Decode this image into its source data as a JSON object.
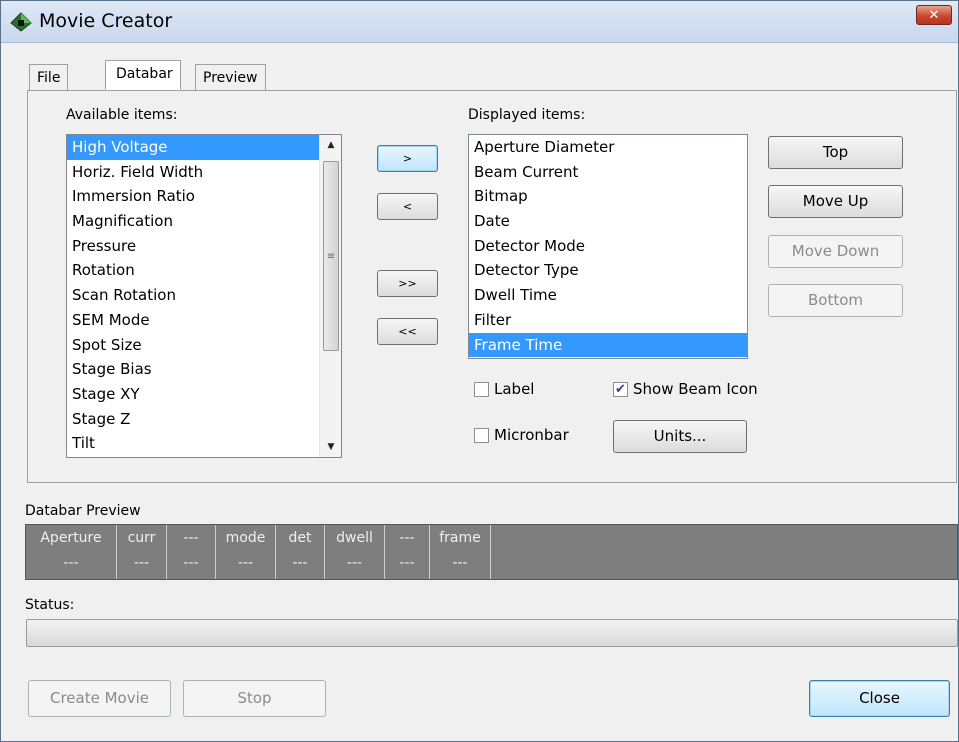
{
  "window": {
    "title": "Movie Creator",
    "close_glyph": "✕"
  },
  "tabs": [
    {
      "label": "File"
    },
    {
      "label": "Databar"
    },
    {
      "label": "Preview"
    }
  ],
  "available": {
    "label": "Available items:",
    "items": [
      "High Voltage",
      "Horiz. Field Width",
      "Immersion Ratio",
      "Magnification",
      "Pressure",
      "Rotation",
      "Scan Rotation",
      "SEM Mode",
      "Spot Size",
      "Stage Bias",
      "Stage XY",
      "Stage Z",
      "Tilt"
    ],
    "selected": "High Voltage"
  },
  "transfer_buttons": {
    "add": ">",
    "remove": "<",
    "add_all": ">>",
    "remove_all": "<<"
  },
  "displayed": {
    "label": "Displayed items:",
    "items": [
      "Aperture Diameter",
      "Beam Current",
      "Bitmap",
      "Date",
      "Detector Mode",
      "Detector Type",
      "Dwell Time",
      "Filter",
      "Frame Time"
    ],
    "selected": "Frame Time"
  },
  "order_buttons": {
    "top": "Top",
    "move_up": "Move Up",
    "move_down": "Move Down",
    "bottom": "Bottom"
  },
  "options": {
    "label": {
      "text": "Label",
      "checked": false
    },
    "show_beam_icon": {
      "text": "Show Beam Icon",
      "checked": true
    },
    "micronbar": {
      "text": "Micronbar",
      "checked": false
    },
    "units_button": "Units..."
  },
  "databar_preview": {
    "label": "Databar Preview",
    "cells": [
      {
        "header": "Aperture",
        "value": "---"
      },
      {
        "header": "curr",
        "value": "---"
      },
      {
        "header": "---",
        "value": "---"
      },
      {
        "header": "mode",
        "value": "---"
      },
      {
        "header": "det",
        "value": "---"
      },
      {
        "header": "dwell",
        "value": "---"
      },
      {
        "header": "---",
        "value": "---"
      },
      {
        "header": "frame",
        "value": "---"
      }
    ]
  },
  "status": {
    "label": "Status:",
    "progress": 0
  },
  "footer": {
    "create_movie": "Create Movie",
    "stop": "Stop",
    "close": "Close"
  },
  "colors": {
    "selection": "#3399ff",
    "preview_bg": "#7e7e7e",
    "titlebar": "#dfe9f6"
  }
}
